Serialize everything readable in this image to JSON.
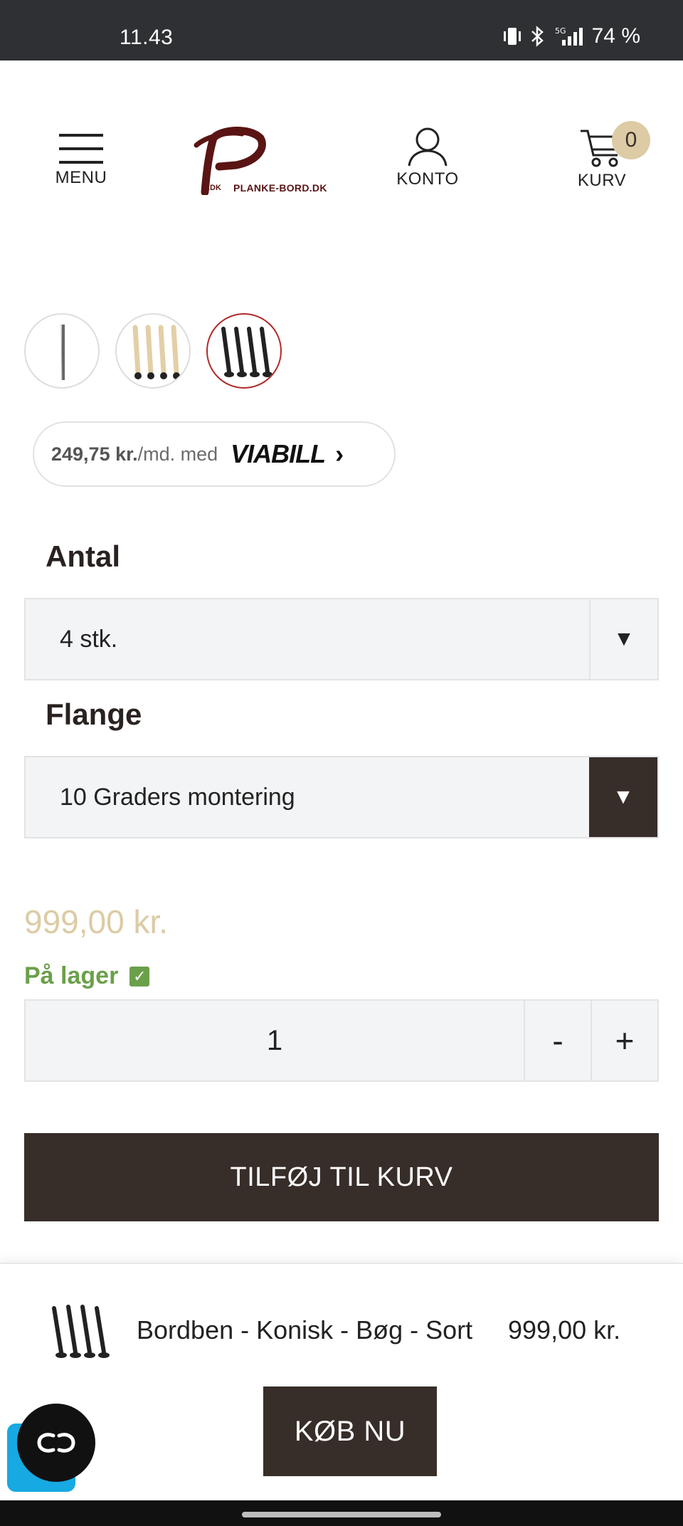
{
  "status_bar": {
    "time": "11.43",
    "battery": "74 %",
    "network": "5G"
  },
  "header": {
    "menu_label": "MENU",
    "logo_text": "PLANKE-BORD.DK",
    "logo_mark": "P",
    "logo_small_top": "Bord",
    "logo_small_bottom": ".DK",
    "account_label": "KONTO",
    "cart_label": "KURV",
    "cart_count": "0"
  },
  "thumbnails": [
    {
      "name": "single-leg",
      "selected": false
    },
    {
      "name": "four-legs-natural",
      "selected": false
    },
    {
      "name": "four-legs-black",
      "selected": true
    }
  ],
  "viabill": {
    "amount": "249,75 kr.",
    "suffix": "/md. med",
    "brand": "VIABILL"
  },
  "options": {
    "antal_label": "Antal",
    "antal_value": "4 stk.",
    "flange_label": "Flange",
    "flange_value": "10 Graders montering"
  },
  "price": "999,00 kr.",
  "stock_label": "På lager",
  "quantity": {
    "value": "1",
    "minus": "-",
    "plus": "+"
  },
  "add_to_cart_label": "TILFØJ TIL KURV",
  "sticky_bar": {
    "product_name": "Bordben - Konisk - Bøg - Sort",
    "product_price": "999,00 kr.",
    "buy_now_label": "KØB NU"
  },
  "colors": {
    "brand_dark": "#372d29",
    "price_tan": "#dccba5",
    "stock_green": "#6ba04a",
    "selected_ring": "#b22a2a"
  }
}
